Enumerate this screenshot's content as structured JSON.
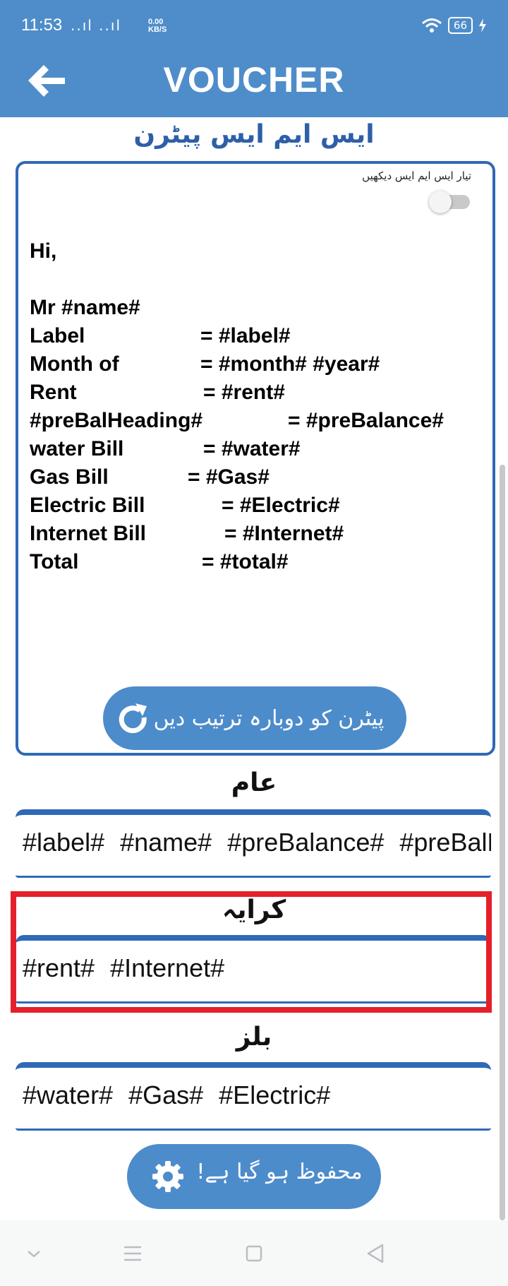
{
  "status_bar": {
    "time": "11:53",
    "signal": "..ıl ..ıl",
    "speed_value": "0.00",
    "speed_unit": "KB/S",
    "battery": "66"
  },
  "app_bar": {
    "title": "VOUCHER"
  },
  "pattern_title": "ایس ایم ایس پیٹرن",
  "template_card": {
    "show_sms_label": "تیار ایس ایم ایس دیکھیں",
    "toggle_on": false,
    "greeting": "Hi,",
    "name_line": "Mr #name#",
    "rows": [
      {
        "key": "Label",
        "value": "= #label#"
      },
      {
        "key": "Month of",
        "value": "= #month# #year#"
      },
      {
        "key": "Rent",
        "value": "= #rent#"
      },
      {
        "key": "#preBalHeading#",
        "value": "= #preBalance#"
      },
      {
        "key": "water Bill",
        "value": "= #water#"
      },
      {
        "key": "Gas Bill",
        "value": "= #Gas#"
      },
      {
        "key": "Electric Bill",
        "value": "= #Electric#"
      },
      {
        "key": "Internet Bill",
        "value": "= #Internet#"
      },
      {
        "key": "Total",
        "value": "= #total#"
      }
    ],
    "reset_button": "پیٹرن کو دوبارہ ترتیب دیں"
  },
  "sections": {
    "general": {
      "title": "عام",
      "chips": [
        "#label#",
        "#name#",
        "#preBalance#",
        "#preBalHeading#"
      ]
    },
    "rent": {
      "title": "کرایہ",
      "chips": [
        "#rent#",
        "#Internet#"
      ]
    },
    "bills": {
      "title": "بلز",
      "chips": [
        "#water#",
        "#Gas#",
        "#Electric#"
      ]
    }
  },
  "save_button": "محفوظ ہو گیا ہے!",
  "colors": {
    "primary": "#4e8dca",
    "border": "#2f69b7",
    "highlight": "#e4202a"
  }
}
